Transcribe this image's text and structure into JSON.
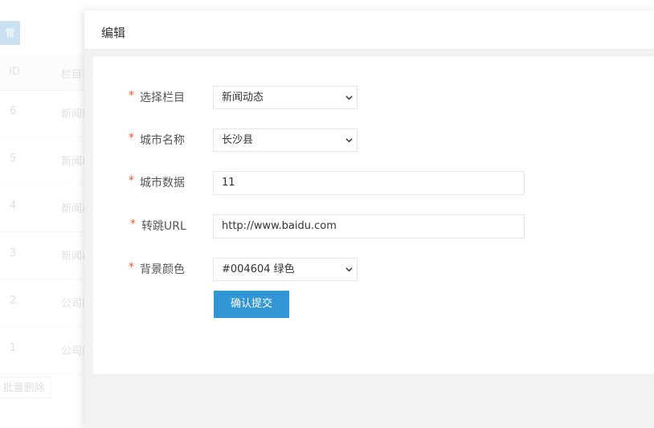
{
  "background": {
    "top_button_label": "管",
    "table": {
      "headers": [
        "ID",
        "栏目名"
      ],
      "rows": [
        {
          "id": "6",
          "name": "新闻动态"
        },
        {
          "id": "5",
          "name": "新闻动态"
        },
        {
          "id": "4",
          "name": "新闻动态"
        },
        {
          "id": "3",
          "name": "新闻动态"
        },
        {
          "id": "2",
          "name": "公司简介"
        },
        {
          "id": "1",
          "name": "公司简介"
        }
      ]
    },
    "batch_delete_label": "批量删除"
  },
  "modal": {
    "title": "编辑",
    "required_mark": "*",
    "fields": {
      "category": {
        "label": "选择栏目",
        "value": "新闻动态"
      },
      "city_name": {
        "label": "城市名称",
        "value": "长沙县"
      },
      "city_data": {
        "label": "城市数据",
        "value": "11"
      },
      "jump_url": {
        "label": "转跳URL",
        "value": "http://www.baidu.com"
      },
      "bg_color": {
        "label": "背景颜色",
        "value": "#004604 绿色"
      }
    },
    "submit_label": "确认提交"
  },
  "colors": {
    "primary": "#3296d4",
    "required": "#ff5722",
    "modal_bg": "#f2f2f2"
  }
}
